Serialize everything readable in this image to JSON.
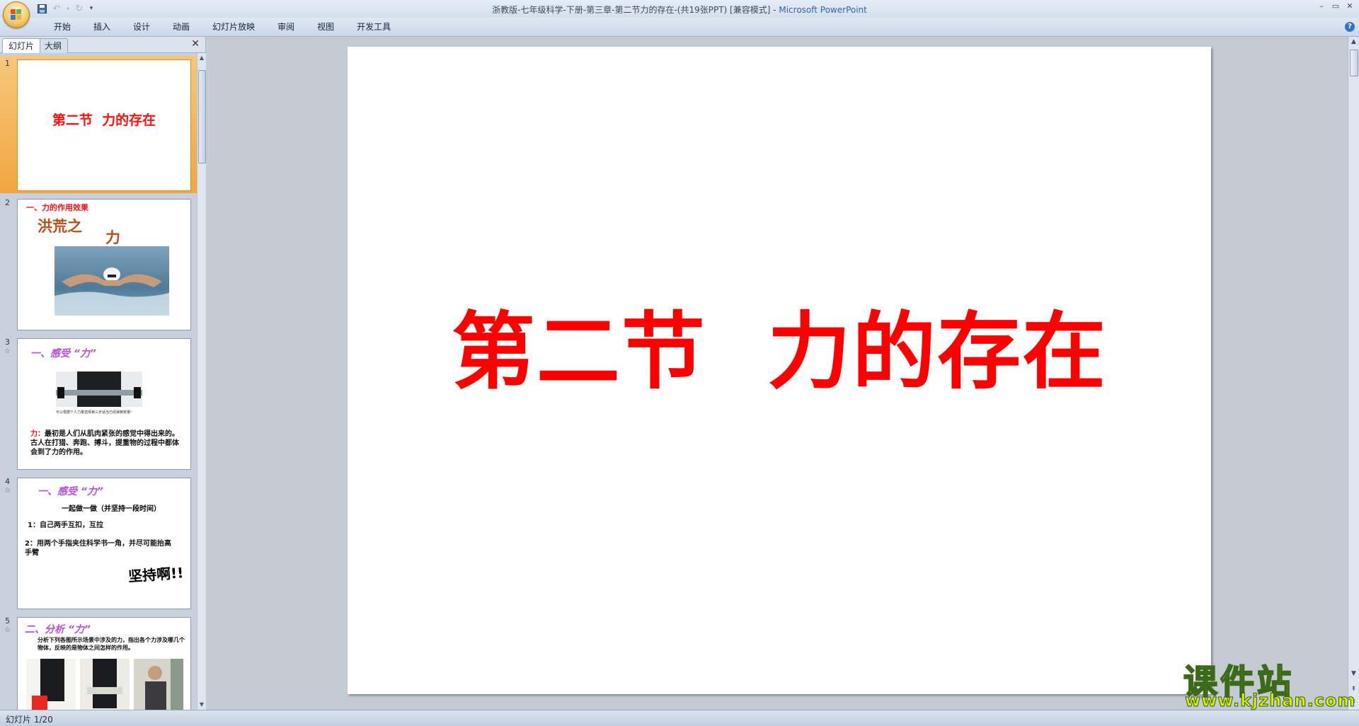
{
  "window": {
    "title": "浙教版-七年级科学-下册-第三章-第二节力的存在-(共19张PPT) [兼容模式] - ",
    "app_name": "Microsoft PowerPoint",
    "controls": [
      "minimize",
      "restore",
      "close"
    ]
  },
  "ribbon": {
    "tabs": [
      "开始",
      "插入",
      "设计",
      "动画",
      "幻灯片放映",
      "审阅",
      "视图",
      "开发工具"
    ]
  },
  "left_pane": {
    "tabs": {
      "slides": "幻灯片",
      "outline": "大纲"
    },
    "slides": [
      {
        "number": "1",
        "title": "第二节  力的存在",
        "selected": true
      },
      {
        "number": "2",
        "heading": "一、力的作用效果",
        "wordart_1": "洪荒之",
        "wordart_2": "力"
      },
      {
        "number": "3",
        "heading": "一、感受 “力”",
        "caption": "可以根据个人力量选择第三步适当已经弹簧数量!",
        "body_label": "力：",
        "body": "最初是人们从肌肉紧张的感觉中得出来的。古人在打猎、奔跑、搏斗，提重物的过程中都体会到了力的作用。"
      },
      {
        "number": "4",
        "heading": "一、感受 “力”",
        "subtitle": "一起做一做（并坚持一段时间）",
        "item1": "1：自己两手互扣，互拉",
        "item2": "2：用两个手指夹住科学书一角，并尽可能抬高手臂",
        "shout": "坚持啊!!"
      },
      {
        "number": "5",
        "heading": "二、分析 “力”",
        "body": "分析下列各图所示场景中涉及的力，指出各个力涉及哪几个物体，反映的是物体之间怎样的作用。"
      }
    ]
  },
  "main_slide": {
    "title": "第二节  力的存在"
  },
  "status_bar": {
    "slide_indicator": "幻灯片 1/20"
  },
  "watermark": {
    "text": "课件站",
    "url": "www.kjzhan.com"
  },
  "colors": {
    "title_red": "#ff0000",
    "selected_thumb": "#f1a640",
    "watermark_yellow": "#f6f30b"
  }
}
